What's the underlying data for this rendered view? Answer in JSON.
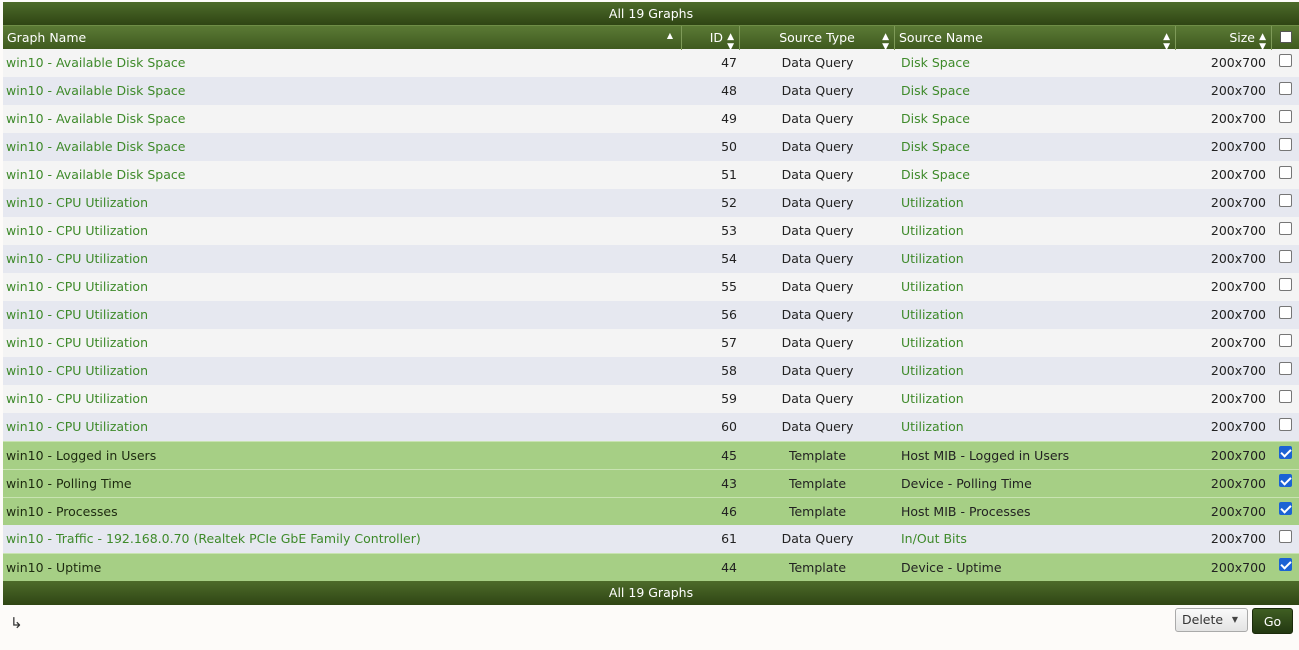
{
  "table": {
    "title": "All 19 Graphs",
    "footer": "All 19 Graphs",
    "columns": {
      "name": "Graph Name",
      "id": "ID",
      "type": "Source Type",
      "source": "Source Name",
      "size": "Size"
    },
    "rows": [
      {
        "name": "win10 - Available Disk Space",
        "id": "47",
        "type": "Data Query",
        "source": "Disk Space",
        "size": "200x700",
        "checked": false
      },
      {
        "name": "win10 - Available Disk Space",
        "id": "48",
        "type": "Data Query",
        "source": "Disk Space",
        "size": "200x700",
        "checked": false
      },
      {
        "name": "win10 - Available Disk Space",
        "id": "49",
        "type": "Data Query",
        "source": "Disk Space",
        "size": "200x700",
        "checked": false
      },
      {
        "name": "win10 - Available Disk Space",
        "id": "50",
        "type": "Data Query",
        "source": "Disk Space",
        "size": "200x700",
        "checked": false
      },
      {
        "name": "win10 - Available Disk Space",
        "id": "51",
        "type": "Data Query",
        "source": "Disk Space",
        "size": "200x700",
        "checked": false
      },
      {
        "name": "win10 - CPU Utilization",
        "id": "52",
        "type": "Data Query",
        "source": "Utilization",
        "size": "200x700",
        "checked": false
      },
      {
        "name": "win10 - CPU Utilization",
        "id": "53",
        "type": "Data Query",
        "source": "Utilization",
        "size": "200x700",
        "checked": false
      },
      {
        "name": "win10 - CPU Utilization",
        "id": "54",
        "type": "Data Query",
        "source": "Utilization",
        "size": "200x700",
        "checked": false
      },
      {
        "name": "win10 - CPU Utilization",
        "id": "55",
        "type": "Data Query",
        "source": "Utilization",
        "size": "200x700",
        "checked": false
      },
      {
        "name": "win10 - CPU Utilization",
        "id": "56",
        "type": "Data Query",
        "source": "Utilization",
        "size": "200x700",
        "checked": false
      },
      {
        "name": "win10 - CPU Utilization",
        "id": "57",
        "type": "Data Query",
        "source": "Utilization",
        "size": "200x700",
        "checked": false
      },
      {
        "name": "win10 - CPU Utilization",
        "id": "58",
        "type": "Data Query",
        "source": "Utilization",
        "size": "200x700",
        "checked": false
      },
      {
        "name": "win10 - CPU Utilization",
        "id": "59",
        "type": "Data Query",
        "source": "Utilization",
        "size": "200x700",
        "checked": false
      },
      {
        "name": "win10 - CPU Utilization",
        "id": "60",
        "type": "Data Query",
        "source": "Utilization",
        "size": "200x700",
        "checked": false
      },
      {
        "name": "win10 - Logged in Users",
        "id": "45",
        "type": "Template",
        "source": "Host MIB - Logged in Users",
        "size": "200x700",
        "checked": true
      },
      {
        "name": "win10 - Polling Time",
        "id": "43",
        "type": "Template",
        "source": "Device - Polling Time",
        "size": "200x700",
        "checked": true
      },
      {
        "name": "win10 - Processes",
        "id": "46",
        "type": "Template",
        "source": "Host MIB - Processes",
        "size": "200x700",
        "checked": true
      },
      {
        "name": "win10 - Traffic - 192.168.0.70 (Realtek PCIe GbE Family Controller)",
        "id": "61",
        "type": "Data Query",
        "source": "In/Out Bits",
        "size": "200x700",
        "checked": false
      },
      {
        "name": "win10 - Uptime",
        "id": "44",
        "type": "Template",
        "source": "Device - Uptime",
        "size": "200x700",
        "checked": true
      }
    ]
  },
  "actions": {
    "selected": "Delete",
    "go_label": "Go"
  },
  "icons": {
    "corner": "return-arrow-icon",
    "sort": "sort-icon"
  },
  "colors": {
    "header_dark": "#2f4514",
    "selected_row": "#a6cf85",
    "link": "#3e8a2a"
  }
}
